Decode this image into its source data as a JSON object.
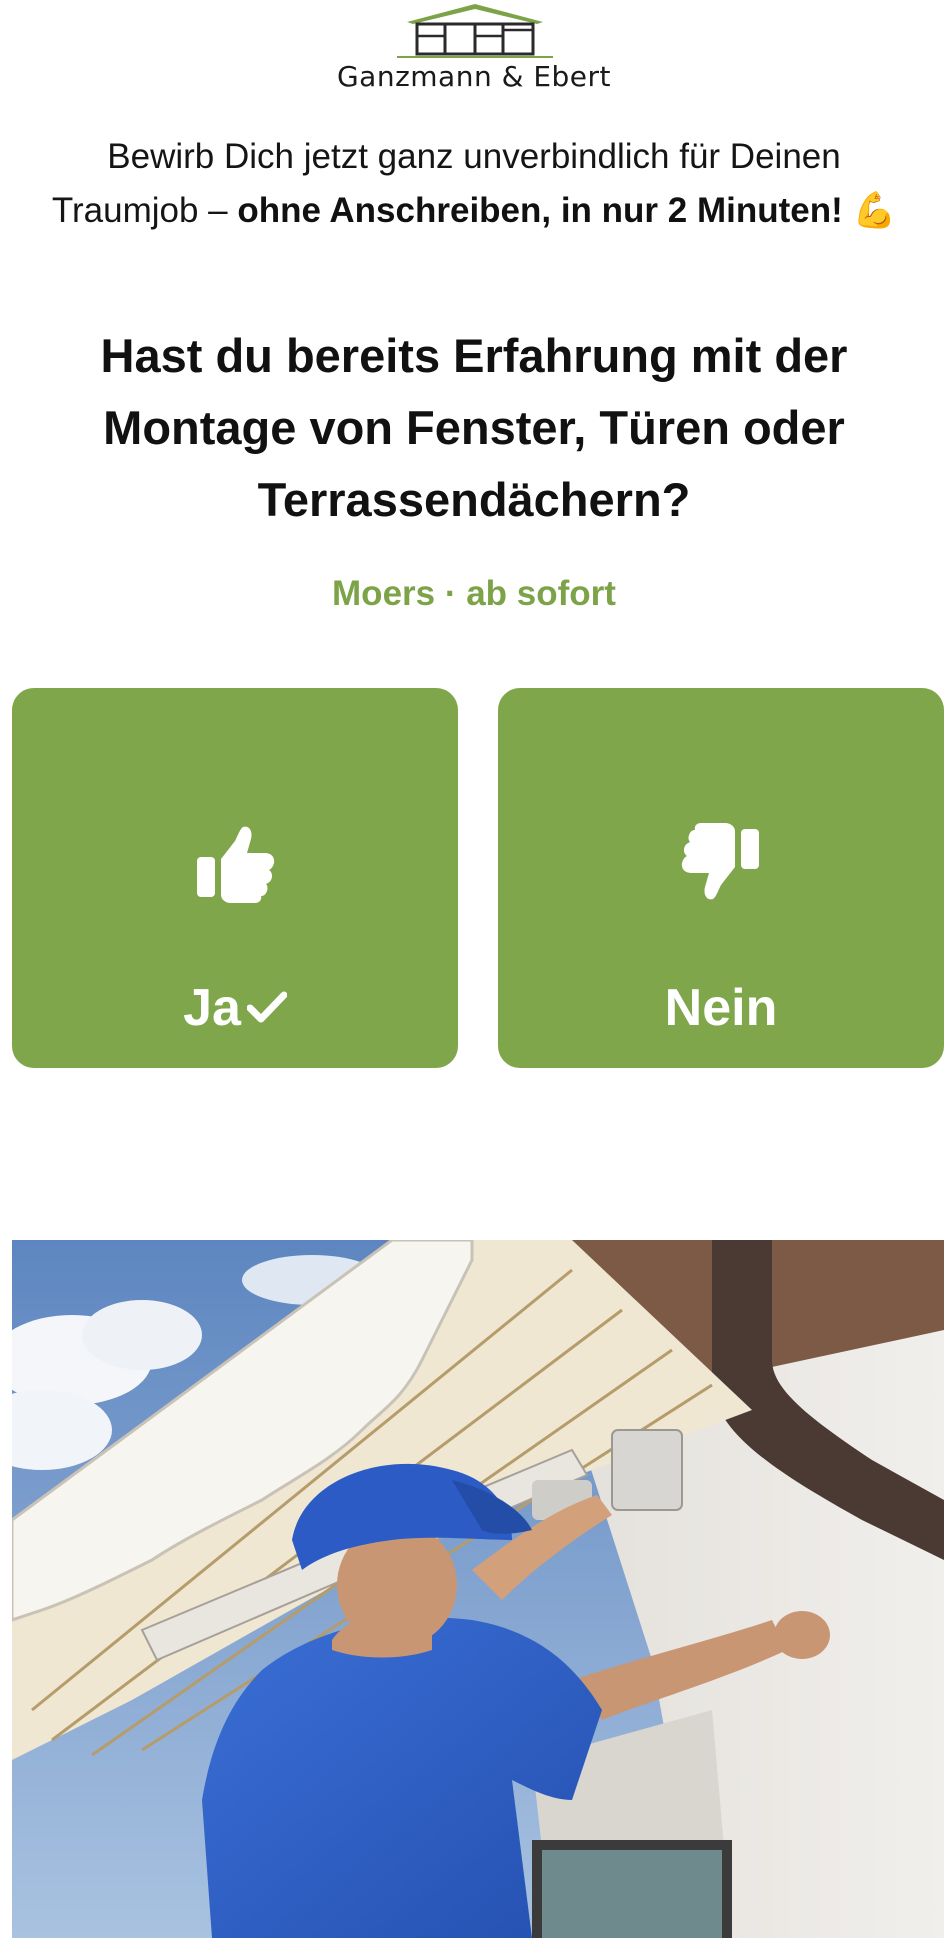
{
  "logo": {
    "name": "Ganzmann & Ebert",
    "accent_color": "#7da349"
  },
  "intro": {
    "text_plain": "Bewirb Dich jetzt ganz unverbindlich für Deinen Traumjob – ",
    "text_bold": "ohne Anschreiben, in nur 2 Minuten!",
    "emoji": "💪"
  },
  "question": {
    "title": "Hast du bereits Erfahrung mit der Montage von Fenster, Türen oder Terrassendächern?",
    "meta": "Moers · ab sofort"
  },
  "answers": {
    "yes": {
      "label": "Ja",
      "icon": "thumbs-up-icon",
      "selected_icon": "checkmark-icon"
    },
    "no": {
      "label": "Nein",
      "icon": "thumbs-down-icon"
    }
  },
  "colors": {
    "brand_green": "#7fa64a",
    "meta_green": "#7da349",
    "text_dark": "#111111"
  }
}
